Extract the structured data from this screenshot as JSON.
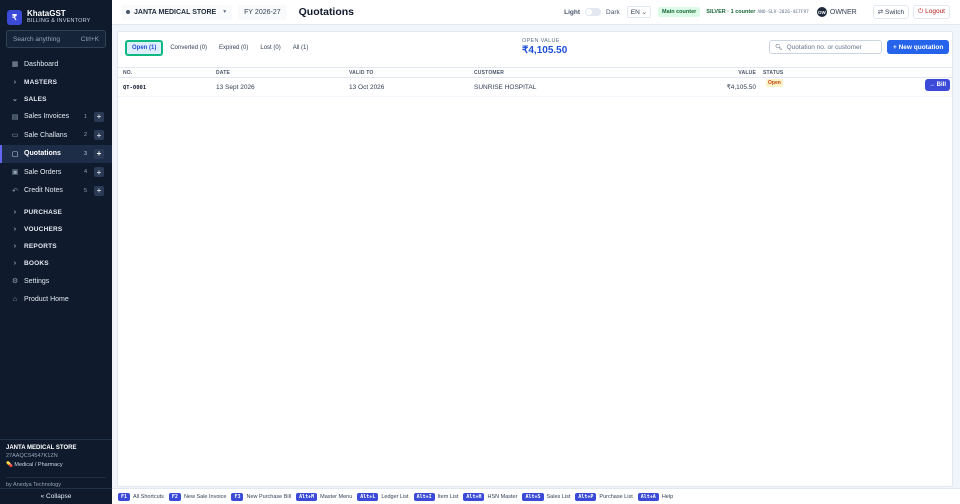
{
  "brand": {
    "logo": "₹",
    "name": "KhataGST",
    "subtitle": "BILLING & INVENTORY"
  },
  "search": {
    "placeholder": "Search anything",
    "shortcut": "Ctrl+K"
  },
  "sidebar": {
    "dashboard": "Dashboard",
    "masters": "MASTERS",
    "sales": "SALES",
    "sales_items": [
      {
        "label": "Sales Invoices",
        "count": "1",
        "icon": "invoice-icon"
      },
      {
        "label": "Sale Challans",
        "count": "2",
        "icon": "challan-icon"
      },
      {
        "label": "Quotations",
        "count": "3",
        "icon": "quotation-icon"
      },
      {
        "label": "Sale Orders",
        "count": "4",
        "icon": "order-icon"
      },
      {
        "label": "Credit Notes",
        "count": "5",
        "icon": "credit-note-icon"
      }
    ],
    "purchase": "PURCHASE",
    "vouchers": "VOUCHERS",
    "reports": "REPORTS",
    "books": "BOOKS",
    "settings": "Settings",
    "product_home": "Product Home",
    "footer": {
      "store": "JANTA MEDICAL STORE",
      "gstin": "27AAQCS4547K1ZN",
      "type": "Medical / Pharmacy",
      "by": "by Anedya Technology"
    },
    "collapse": "« Collapse"
  },
  "topbar": {
    "store": "JANTA MEDICAL STORE",
    "fy": "FY 2026-27",
    "title": "Quotations",
    "theme_light": "Light",
    "theme_dark": "Dark",
    "lang": "EN",
    "main_counter": "Main counter",
    "plan": "SILVER · 1 counter",
    "plan_code": "ANO-SLV-2026-4E7F97",
    "avatar": "OW",
    "owner": "OWNER",
    "switch": "Switch",
    "logout": "Logout"
  },
  "tabs": [
    {
      "label": "Open (1)"
    },
    {
      "label": "Converted (0)"
    },
    {
      "label": "Expired (0)"
    },
    {
      "label": "Lost (0)"
    },
    {
      "label": "All (1)"
    }
  ],
  "open_value": {
    "label": "OPEN VALUE",
    "amount": "₹4,105.50"
  },
  "quotation_search": {
    "placeholder": "Quotation no. or customer"
  },
  "new_quotation": "+ New quotation",
  "table": {
    "headers": {
      "no": "NO.",
      "date": "DATE",
      "valid_to": "VALID TO",
      "customer": "CUSTOMER",
      "value": "VALUE",
      "status": "STATUS"
    },
    "rows": [
      {
        "no": "QT-0001",
        "date": "13 Sept 2026",
        "valid_to": "13 Oct 2026",
        "customer": "SUNRISE HOSPITAL",
        "value": "₹4,105.50",
        "status": "Open",
        "action": "→ Bill"
      }
    ]
  },
  "shortcuts": [
    {
      "key": "F1",
      "label": "All Shortcuts"
    },
    {
      "key": "F2",
      "label": "New Sale Invoice"
    },
    {
      "key": "F3",
      "label": "New Purchase Bill"
    },
    {
      "key": "Alt+M",
      "label": "Master Menu"
    },
    {
      "key": "Alt+L",
      "label": "Ledger List"
    },
    {
      "key": "Alt+I",
      "label": "Item List"
    },
    {
      "key": "Alt+H",
      "label": "HSN Master"
    },
    {
      "key": "Alt+S",
      "label": "Sales List"
    },
    {
      "key": "Alt+P",
      "label": "Purchase List"
    },
    {
      "key": "Alt+A",
      "label": "Help"
    }
  ]
}
